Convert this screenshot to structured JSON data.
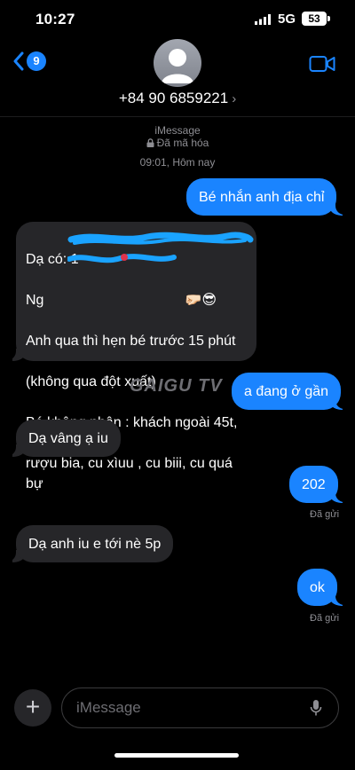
{
  "status_bar": {
    "time": "10:27",
    "network": "5G",
    "battery": "53"
  },
  "header": {
    "unread_count": "9",
    "contact": "+84 90 6859221",
    "contact_chevron": "›",
    "icons": {
      "back": "chevron-left-icon",
      "video": "video-camera-icon",
      "avatar": "person-silhouette"
    }
  },
  "thread": {
    "service": "iMessage",
    "encryption": "Đã mã hóa",
    "timestamp": "09:01, Hôm nay"
  },
  "messages": [
    {
      "direction": "out",
      "text": "Bé nhắn anh địa chỉ"
    },
    {
      "direction": "in",
      "lines": [
        "Dạ có: 1",
        "Ng",
        "Anh qua thì hẹn bé trước 15 phút",
        "(không qua đột xuất)",
        "Bé không nhận : khách ngoài 45t,",
        "rượu bia, cu xìuu , cu biii, cu quá bự"
      ],
      "emoji": "🤛🏻😎",
      "redacted": true
    },
    {
      "direction": "out",
      "text": "a đang ở gần"
    },
    {
      "direction": "in",
      "text": "Dạ vâng ạ iu"
    },
    {
      "direction": "out",
      "text": "202",
      "status": "Đã gửi"
    },
    {
      "direction": "in",
      "text": "Dạ anh iu e tới nè 5p"
    },
    {
      "direction": "out",
      "text": "ok",
      "status": "Đã gửi"
    }
  ],
  "watermark": "GAIGU TV",
  "composer": {
    "placeholder": "iMessage",
    "plus": "+"
  },
  "colors": {
    "outgoing": "#1a84ff",
    "incoming": "#262629",
    "background": "#000000",
    "secondary_text": "#8e8e93",
    "scribble": "#1aa3ff"
  }
}
